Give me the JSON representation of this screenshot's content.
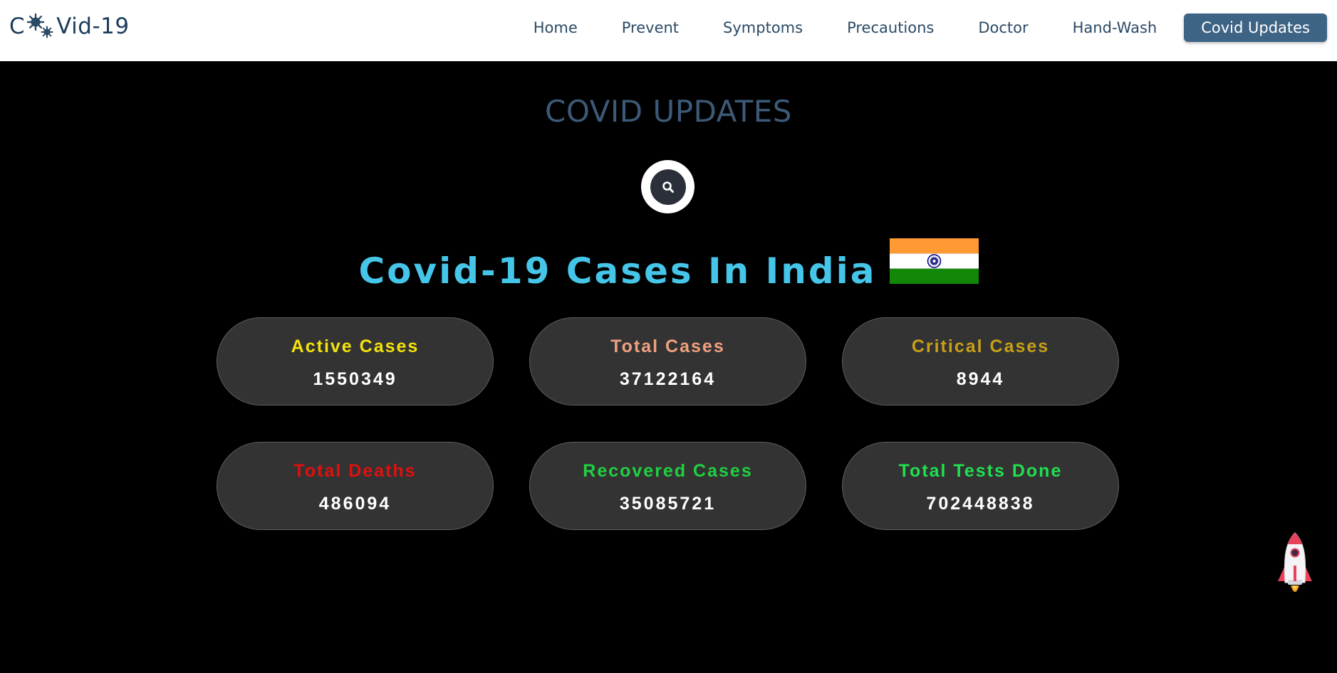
{
  "navbar": {
    "logo": {
      "prefix": "C",
      "suffix": "Vid-19",
      "icon": "virus-icon"
    },
    "links": [
      {
        "label": "Home"
      },
      {
        "label": "Prevent"
      },
      {
        "label": "Symptoms"
      },
      {
        "label": "Precautions"
      },
      {
        "label": "Doctor"
      },
      {
        "label": "Hand-Wash"
      },
      {
        "label": "Covid Updates",
        "active": true
      }
    ]
  },
  "main": {
    "section_title": "COVID UPDATES",
    "search_icon": "search-icon",
    "country_heading": "Covid-19 Cases In India",
    "flag_icon": "india-flag-icon",
    "stats": [
      {
        "label": "Active Cases",
        "value": "1550349",
        "color": "#f5e20c"
      },
      {
        "label": "Total Cases",
        "value": "37122164",
        "color": "#f0a080"
      },
      {
        "label": "Critical Cases",
        "value": "8944",
        "color": "#c8a018"
      },
      {
        "label": "Total Deaths",
        "value": "486094",
        "color": "#e01010"
      },
      {
        "label": "Recovered Cases",
        "value": "35085721",
        "color": "#20d040"
      },
      {
        "label": "Total Tests Done",
        "value": "702448838",
        "color": "#20e050"
      }
    ],
    "scroll_top_icon": "rocket-icon"
  },
  "colors": {
    "brand": "#1d3d5c",
    "nav_text": "#2b4a66",
    "active_button": "#3e6485",
    "page_background": "#000000",
    "card_background": "#333333",
    "section_title": "#3c5a78",
    "heading": "#45c6e8"
  }
}
